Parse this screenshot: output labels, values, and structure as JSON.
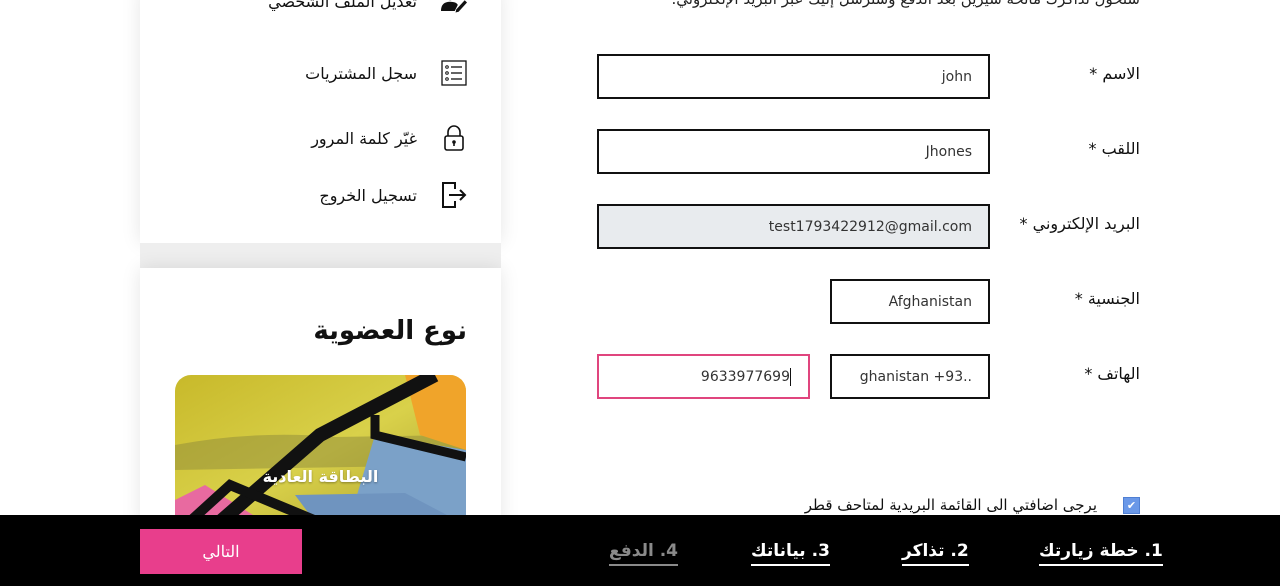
{
  "sidebar": {
    "items": [
      {
        "label": "تعديل الملف الشخصي",
        "icon": "edit-user-icon"
      },
      {
        "label": "سجل المشتريات",
        "icon": "list-icon"
      },
      {
        "label": "غيّر كلمة المرور",
        "icon": "lock-icon"
      },
      {
        "label": "تسجيل الخروج",
        "icon": "logout-icon"
      }
    ]
  },
  "membership": {
    "title": "نوع العضوية",
    "card_label": "البطاقة العادية"
  },
  "form": {
    "top_note": "ستحول تذاكرك ماتحة شيرين بعد الدفع وستُرسل إليك عبر البريد الإلكتروني.",
    "first_name": {
      "label": "الاسم *",
      "value": "john"
    },
    "last_name": {
      "label": "اللقب *",
      "value": "Jhones"
    },
    "email": {
      "label": "البريد الإلكتروني *",
      "value": "test1793422912@gmail.com"
    },
    "nationality": {
      "label": "الجنسية *",
      "value": "Afghanistan"
    },
    "phone": {
      "label": "الهاتف *",
      "country": "ghanistan +93..",
      "value": "9633977699"
    },
    "newsletter": {
      "label": "يرجى اضافتي الى القائمة البريدية لمتاحف قطر",
      "checked": true
    }
  },
  "footer": {
    "next_label": "التالي",
    "steps": [
      {
        "label": "1. خطة زيارتك",
        "active": true
      },
      {
        "label": "2. تذاكر",
        "active": true
      },
      {
        "label": "3. بياناتك",
        "active": true
      },
      {
        "label": "4. الدفع",
        "active": false
      }
    ]
  },
  "colors": {
    "accent": "#e83e8c",
    "focus_border": "#e0457e",
    "checkbox": "#6a98e8",
    "bar": "#000000"
  }
}
